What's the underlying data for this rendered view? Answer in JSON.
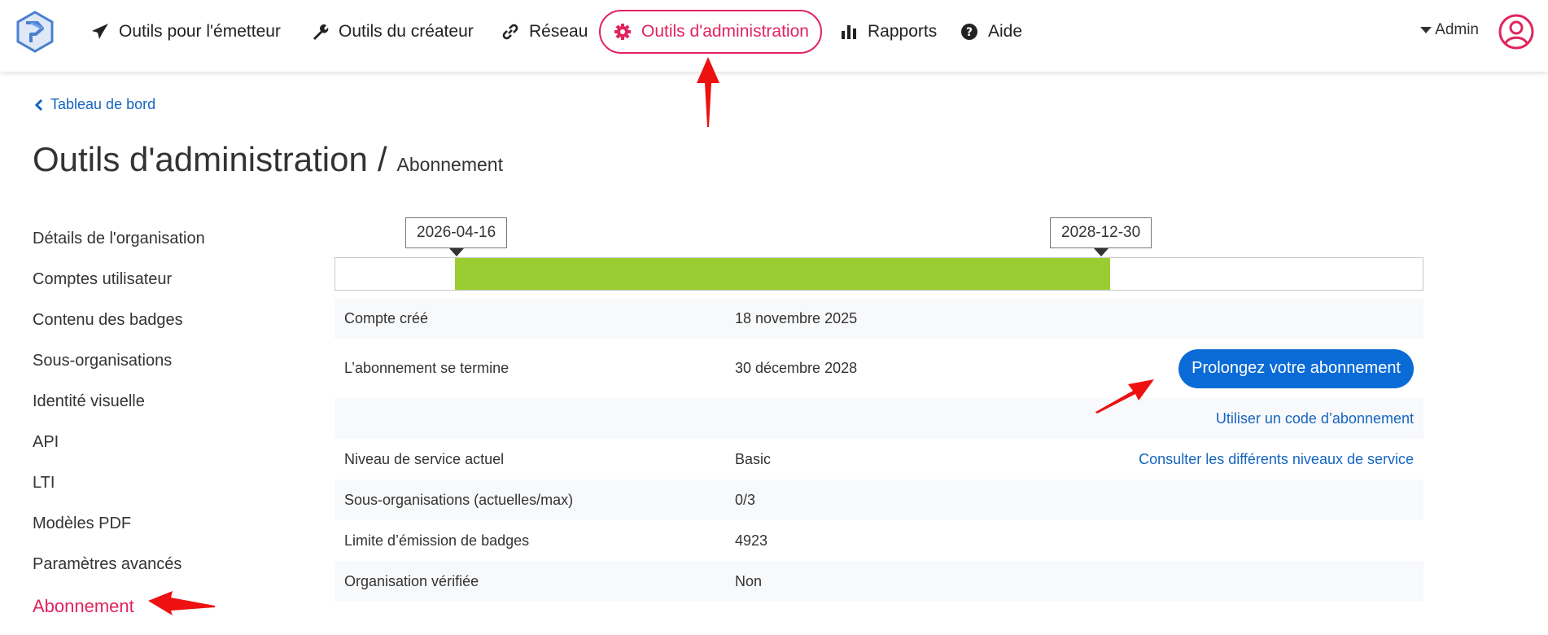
{
  "colors": {
    "accent": "#e0245e",
    "link": "#1565c0",
    "primary_button": "#0b6bd6",
    "progress": "#9acd32",
    "annotation": "#ee1111"
  },
  "nav": {
    "logo_icon": "stacked-chevron-logo",
    "items": [
      {
        "label": "Outils pour l'émetteur",
        "icon": "paper-plane-icon"
      },
      {
        "label": "Outils du créateur",
        "icon": "wrench-icon"
      },
      {
        "label": "Réseau",
        "icon": "link-icon"
      },
      {
        "label": "Outils d'administration",
        "icon": "gear-icon",
        "active": true
      },
      {
        "label": "Rapports",
        "icon": "bar-chart-icon"
      },
      {
        "label": "Aide",
        "icon": "question-circle-icon"
      }
    ],
    "user_menu_label": "Admin",
    "avatar_icon": "user-circle-icon"
  },
  "breadcrumb": {
    "label": "Tableau de bord"
  },
  "title": {
    "main": "Outils d'administration",
    "separator": "/",
    "sub": "Abonnement"
  },
  "sidebar": {
    "items": [
      {
        "label": "Détails de l'organisation"
      },
      {
        "label": "Comptes utilisateur"
      },
      {
        "label": "Contenu des badges"
      },
      {
        "label": "Sous-organisations"
      },
      {
        "label": "Identité visuelle"
      },
      {
        "label": "API"
      },
      {
        "label": "LTI"
      },
      {
        "label": "Modèles PDF"
      },
      {
        "label": "Paramètres avancés"
      },
      {
        "label": "Abonnement",
        "active": true
      }
    ]
  },
  "timeline": {
    "start_label": "2026-04-16",
    "end_label": "2028-12-30"
  },
  "info": {
    "rows": [
      {
        "label": "Compte créé",
        "value": "18 novembre 2025"
      },
      {
        "label": "L’abonnement se termine",
        "value": "30 décembre 2028",
        "action": "Prolongez votre abonnement"
      },
      {
        "label": "",
        "value": "",
        "action": "Utiliser un code d’abonnement"
      },
      {
        "label": "Niveau de service actuel",
        "value": "Basic",
        "action": "Consulter les différents niveaux de service"
      },
      {
        "label": "Sous-organisations (actuelles/max)",
        "value": "0/3"
      },
      {
        "label": "Limite d’émission de badges",
        "value": "4923"
      },
      {
        "label": "Organisation vérifiée",
        "value": "Non"
      }
    ]
  }
}
